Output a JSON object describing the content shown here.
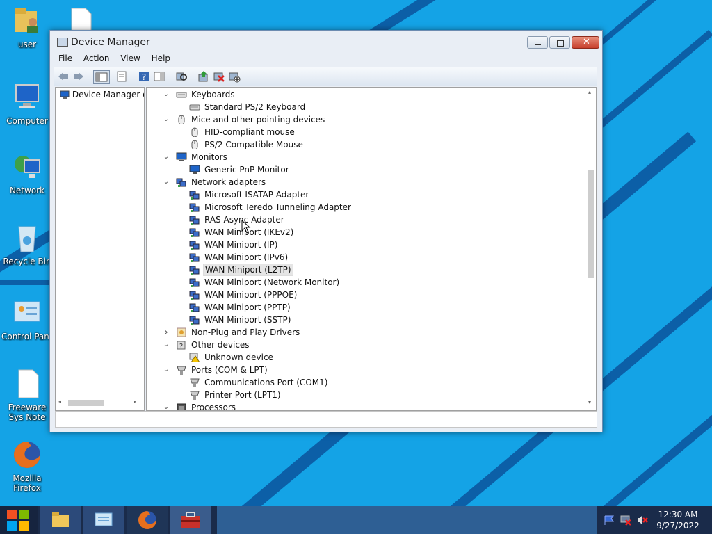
{
  "desktop": {
    "icons": [
      {
        "label": "user"
      },
      {
        "label": "Computer"
      },
      {
        "label": "Network"
      },
      {
        "label": "Recycle Bin"
      },
      {
        "label": "Control Panel"
      },
      {
        "label": "Freeware Sys Note read this"
      },
      {
        "label": "Mozilla Firefox"
      }
    ]
  },
  "window": {
    "title": "Device Manager",
    "menu": [
      "File",
      "Action",
      "View",
      "Help"
    ],
    "left_pane_item": "Device Manager on",
    "tree": [
      {
        "label": "Keyboards",
        "level": 0,
        "expanded": true,
        "icon": "keyboard-icon"
      },
      {
        "label": "Standard PS/2 Keyboard",
        "level": 1,
        "icon": "keyboard-icon"
      },
      {
        "label": "Mice and other pointing devices",
        "level": 0,
        "expanded": true,
        "icon": "mouse-icon"
      },
      {
        "label": "HID-compliant mouse",
        "level": 1,
        "icon": "mouse-icon"
      },
      {
        "label": "PS/2 Compatible Mouse",
        "level": 1,
        "icon": "mouse-icon"
      },
      {
        "label": "Monitors",
        "level": 0,
        "expanded": true,
        "icon": "monitor-icon"
      },
      {
        "label": "Generic PnP Monitor",
        "level": 1,
        "icon": "monitor-icon"
      },
      {
        "label": "Network adapters",
        "level": 0,
        "expanded": true,
        "icon": "network-adapter-icon"
      },
      {
        "label": "Microsoft ISATAP Adapter",
        "level": 1,
        "icon": "network-adapter-icon"
      },
      {
        "label": "Microsoft Teredo Tunneling Adapter",
        "level": 1,
        "icon": "network-adapter-icon"
      },
      {
        "label": "RAS Async Adapter",
        "level": 1,
        "icon": "network-adapter-icon"
      },
      {
        "label": "WAN Miniport (IKEv2)",
        "level": 1,
        "icon": "network-adapter-icon"
      },
      {
        "label": "WAN Miniport (IP)",
        "level": 1,
        "icon": "network-adapter-icon"
      },
      {
        "label": "WAN Miniport (IPv6)",
        "level": 1,
        "icon": "network-adapter-icon"
      },
      {
        "label": "WAN Miniport (L2TP)",
        "level": 1,
        "icon": "network-adapter-icon",
        "selected": true
      },
      {
        "label": "WAN Miniport (Network Monitor)",
        "level": 1,
        "icon": "network-adapter-icon"
      },
      {
        "label": "WAN Miniport (PPPOE)",
        "level": 1,
        "icon": "network-adapter-icon"
      },
      {
        "label": "WAN Miniport (PPTP)",
        "level": 1,
        "icon": "network-adapter-icon"
      },
      {
        "label": "WAN Miniport (SSTP)",
        "level": 1,
        "icon": "network-adapter-icon"
      },
      {
        "label": "Non-Plug and Play Drivers",
        "level": 0,
        "expanded": false,
        "icon": "driver-icon"
      },
      {
        "label": "Other devices",
        "level": 0,
        "expanded": true,
        "icon": "unknown-device-icon"
      },
      {
        "label": "Unknown device",
        "level": 1,
        "icon": "warning-device-icon"
      },
      {
        "label": "Ports (COM & LPT)",
        "level": 0,
        "expanded": true,
        "icon": "port-icon"
      },
      {
        "label": "Communications Port (COM1)",
        "level": 1,
        "icon": "port-icon"
      },
      {
        "label": "Printer Port (LPT1)",
        "level": 1,
        "icon": "port-icon"
      },
      {
        "label": "Processors",
        "level": 0,
        "expanded": true,
        "icon": "processor-icon"
      }
    ]
  },
  "taskbar": {
    "time": "12:30 AM",
    "date": "9/27/2022"
  },
  "colors": {
    "desktop": "#14a3e6",
    "taskbar": "#1a2b4a",
    "close_button": "#c7402d"
  }
}
